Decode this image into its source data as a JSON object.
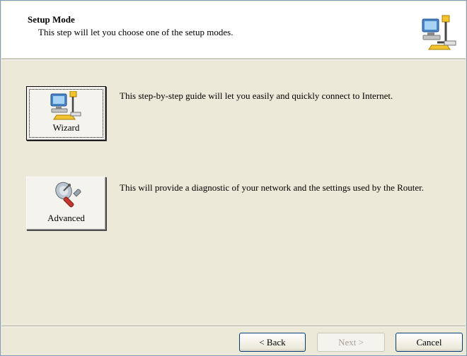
{
  "header": {
    "title": "Setup Mode",
    "subtitle": "This step will let you choose one of the setup modes.",
    "icon": "network-computer-icon"
  },
  "options": [
    {
      "label": "Wizard",
      "icon": "network-computer-icon",
      "description": "This step-by-step guide will let you easily and quickly connect to Internet.",
      "focused": true
    },
    {
      "label": "Advanced",
      "icon": "satellite-dish-wrench-icon",
      "description": "This will provide a diagnostic of your network and the settings used by the Router.",
      "focused": false
    }
  ],
  "nav": {
    "back_label": "< Back",
    "next_label": "Next >",
    "next_enabled": false,
    "cancel_label": "Cancel"
  },
  "colors": {
    "window_bg": "#ece9d8",
    "border": "#7f9db9",
    "button_border": "#003c74"
  }
}
